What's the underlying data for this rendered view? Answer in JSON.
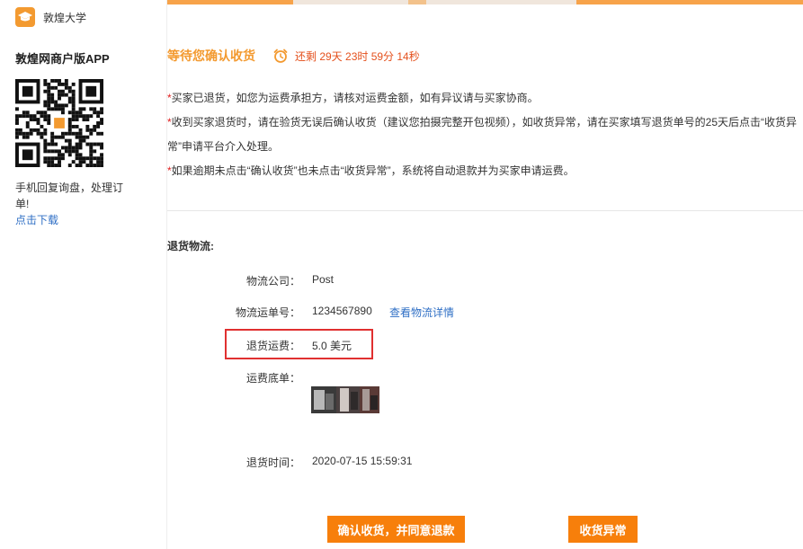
{
  "sidebar": {
    "brand_name": "敦煌大学",
    "app_title": "敦煌网商户版APP",
    "app_desc": "手机回复询盘，处理订单!",
    "download_link": "点击下载"
  },
  "status": {
    "title": "等待您确认收货",
    "countdown": "还剩 29天 23时 59分 14秒"
  },
  "notes": [
    "买家已退货，如您为运费承担方，请核对运费金额，如有异议请与买家协商。",
    "收到买家退货时，请在验货无误后确认收货（建议您拍摄完整开包视频），如收货异常，请在买家填写退货单号的25天后点击“收货异常”申请平台介入处理。",
    "如果逾期未点击“确认收货”也未点击“收货异常”，系统将自动退款并为买家申请运费。"
  ],
  "notes_marker": "*",
  "logistics": {
    "section_title": "退货物流:",
    "company_label": "物流公司：",
    "company_value": "Post",
    "tracking_label": "物流运单号：",
    "tracking_value": "1234567890",
    "tracking_link": "查看物流详情",
    "fee_label": "退货运费：",
    "fee_value": "5.0 美元",
    "receipt_label": "运费底单：",
    "time_label": "退货时间：",
    "time_value": "2020-07-15 15:59:31"
  },
  "actions": {
    "confirm_label": "确认收货，并同意退款",
    "abnormal_label": "收货异常"
  },
  "colors": {
    "accent": "#f39a30",
    "button": "#f77f0b",
    "countdown": "#e4501c",
    "link": "#2f6fc5",
    "highlight": "#e03030"
  }
}
